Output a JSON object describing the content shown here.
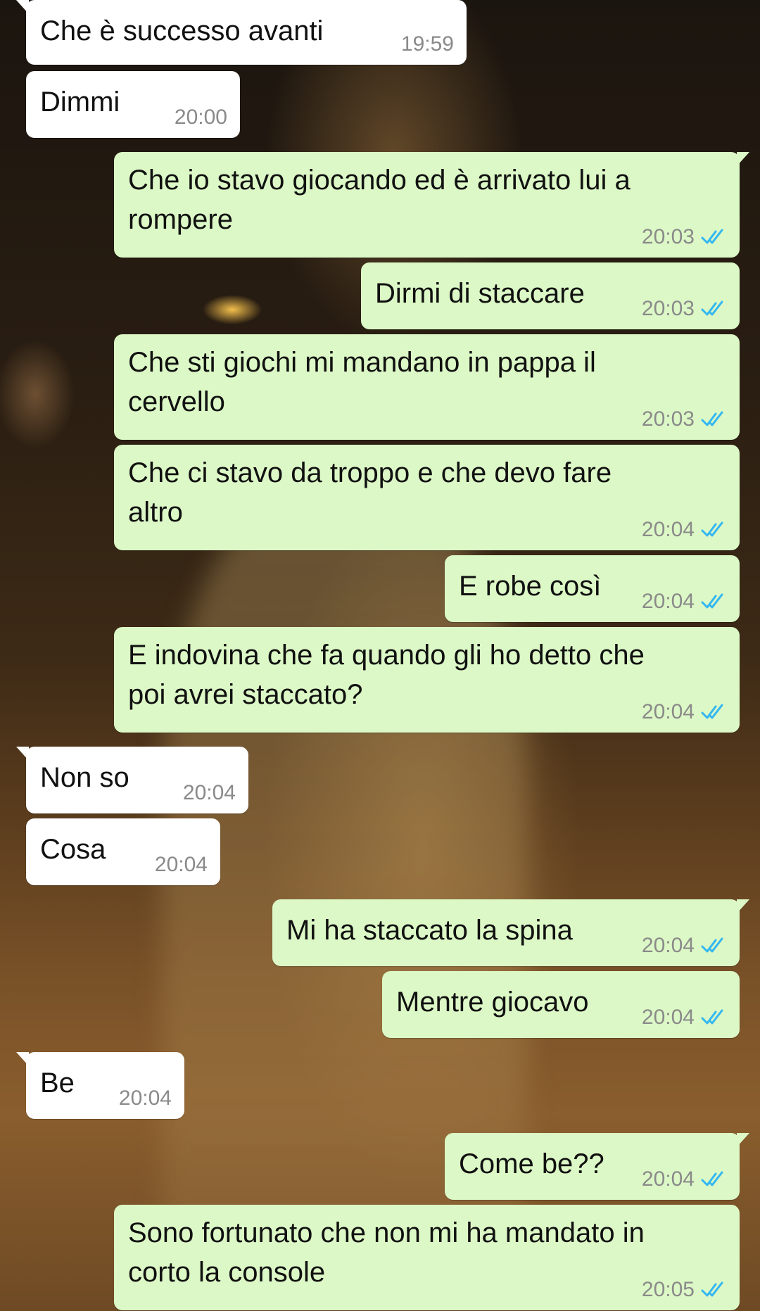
{
  "conversation": {
    "messages": [
      {
        "dir": "in",
        "text": "Che è successo avanti",
        "time": "19:59"
      },
      {
        "dir": "in",
        "text": "Dimmi",
        "time": "20:00"
      },
      {
        "dir": "out",
        "text": "Che io stavo giocando ed è arrivato lui a\nrompere",
        "time": "20:03"
      },
      {
        "dir": "out",
        "text": "Dirmi di staccare",
        "time": "20:03"
      },
      {
        "dir": "out",
        "text": "Che sti giochi mi mandano in pappa il\ncervello",
        "time": "20:03"
      },
      {
        "dir": "out",
        "text": "Che ci stavo da troppo e che devo fare\naltro",
        "time": "20:04"
      },
      {
        "dir": "out",
        "text": "E robe così",
        "time": "20:04"
      },
      {
        "dir": "out",
        "text": "E indovina che fa quando gli ho detto che\npoi avrei staccato?",
        "time": "20:04"
      },
      {
        "dir": "in",
        "text": "Non so",
        "time": "20:04"
      },
      {
        "dir": "in",
        "text": "Cosa",
        "time": "20:04"
      },
      {
        "dir": "out",
        "text": "Mi ha staccato la spina",
        "time": "20:04"
      },
      {
        "dir": "out",
        "text": "Mentre giocavo",
        "time": "20:04"
      },
      {
        "dir": "in",
        "text": "Be",
        "time": "20:04"
      },
      {
        "dir": "out",
        "text": "Come be??",
        "time": "20:04"
      },
      {
        "dir": "out",
        "text": "Sono fortunato che non mi ha mandato in\ncorto la console",
        "time": "20:05"
      }
    ]
  },
  "colors": {
    "incoming_bubble": "#ffffff",
    "outgoing_bubble": "#dcf8c6",
    "read_ticks": "#34b7f1",
    "timestamp": "#8a8a8a"
  },
  "icons": {
    "read_receipt": "double-check-icon"
  }
}
